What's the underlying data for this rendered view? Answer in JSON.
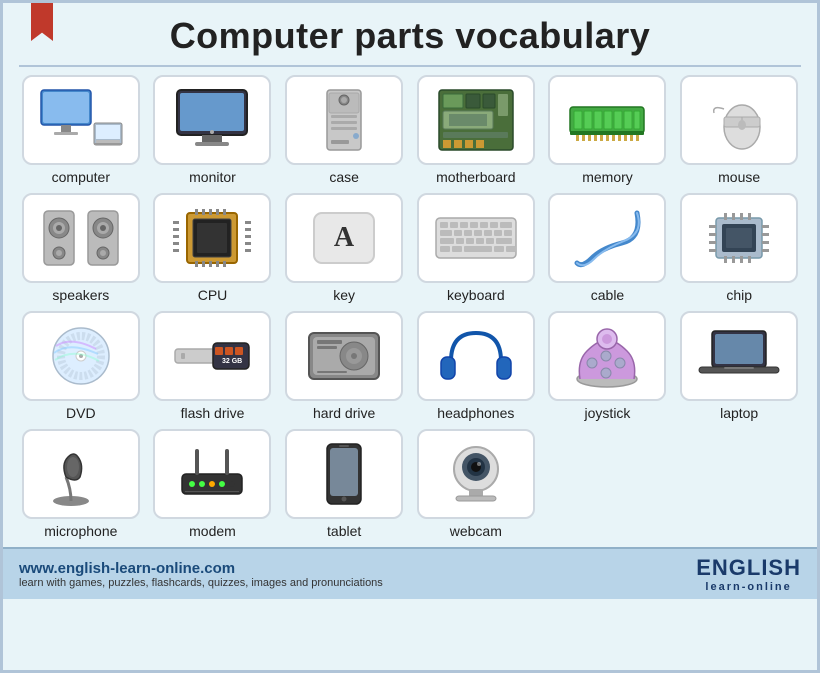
{
  "page": {
    "title": "Computer parts vocabulary",
    "footer": {
      "url": "www.english-learn-online.com",
      "tagline": "learn with games, puzzles, flashcards, quizzes, images and pronunciations",
      "logo_main": "ENGLISH",
      "logo_sub": "learn-online"
    }
  },
  "items": [
    {
      "id": "computer",
      "label": "computer",
      "icon": "computer"
    },
    {
      "id": "monitor",
      "label": "monitor",
      "icon": "monitor"
    },
    {
      "id": "case",
      "label": "case",
      "icon": "case"
    },
    {
      "id": "motherboard",
      "label": "motherboard",
      "icon": "motherboard"
    },
    {
      "id": "memory",
      "label": "memory",
      "icon": "memory"
    },
    {
      "id": "mouse",
      "label": "mouse",
      "icon": "mouse"
    },
    {
      "id": "speakers",
      "label": "speakers",
      "icon": "speakers"
    },
    {
      "id": "cpu",
      "label": "CPU",
      "icon": "cpu"
    },
    {
      "id": "key",
      "label": "key",
      "icon": "key"
    },
    {
      "id": "keyboard",
      "label": "keyboard",
      "icon": "keyboard"
    },
    {
      "id": "cable",
      "label": "cable",
      "icon": "cable"
    },
    {
      "id": "chip",
      "label": "chip",
      "icon": "chip"
    },
    {
      "id": "dvd",
      "label": "DVD",
      "icon": "dvd"
    },
    {
      "id": "flash-drive",
      "label": "flash drive",
      "icon": "flash-drive"
    },
    {
      "id": "hard-drive",
      "label": "hard drive",
      "icon": "hard-drive"
    },
    {
      "id": "headphones",
      "label": "headphones",
      "icon": "headphones"
    },
    {
      "id": "joystick",
      "label": "joystick",
      "icon": "joystick"
    },
    {
      "id": "laptop",
      "label": "laptop",
      "icon": "laptop"
    },
    {
      "id": "microphone",
      "label": "microphone",
      "icon": "microphone"
    },
    {
      "id": "modem",
      "label": "modem",
      "icon": "modem"
    },
    {
      "id": "tablet",
      "label": "tablet",
      "icon": "tablet"
    },
    {
      "id": "webcam",
      "label": "webcam",
      "icon": "webcam"
    }
  ]
}
